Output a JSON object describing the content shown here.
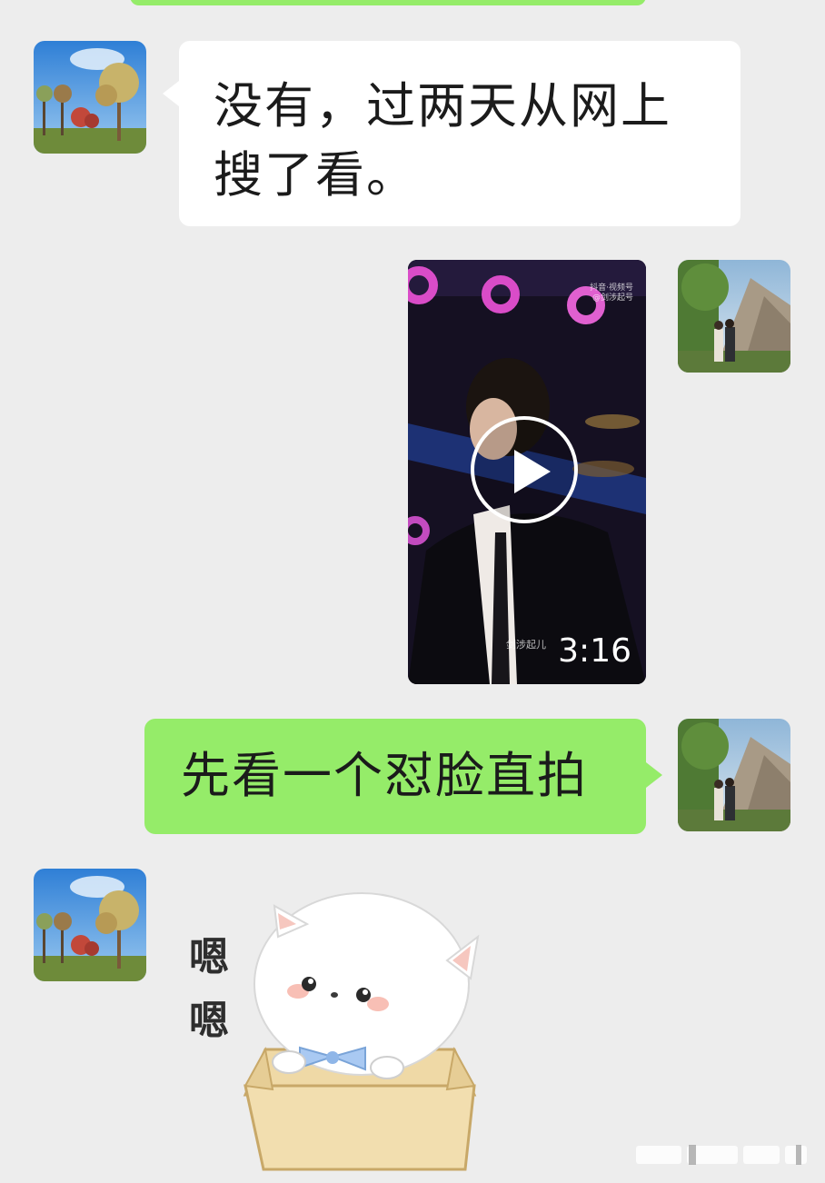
{
  "messages": [
    {
      "sender": "other",
      "type": "text",
      "text_line1": "没有，过两天从网上",
      "text_line2": "搜了看。"
    },
    {
      "sender": "self",
      "type": "video",
      "duration": "3:16",
      "watermark_top_line1": "抖音·视频号",
      "watermark_top_line2": "@剑涉起号",
      "watermark_bottom": "剑涉起儿"
    },
    {
      "sender": "self",
      "type": "text",
      "text": "先看一个怼脸直拍"
    },
    {
      "sender": "other",
      "type": "sticker",
      "sticker_text_1": "嗯",
      "sticker_text_2": "嗯"
    }
  ],
  "colors": {
    "background": "#ededed",
    "self_bubble": "#95ec69",
    "other_bubble": "#ffffff",
    "text": "#1b1b1b"
  },
  "icons": {
    "play": "play-circle-icon",
    "other_avatar": "tree-landscape-avatar",
    "self_avatar": "mountain-couple-avatar"
  }
}
